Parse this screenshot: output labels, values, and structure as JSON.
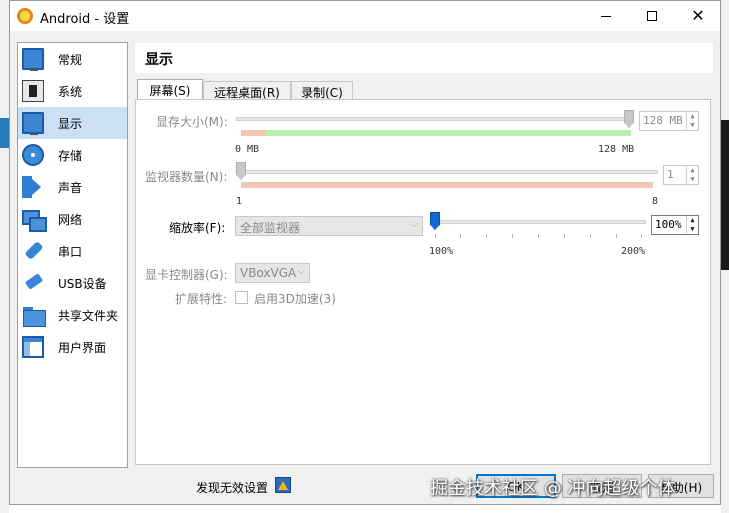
{
  "window": {
    "title": "Android - 设置"
  },
  "sidebar": {
    "items": [
      {
        "label": "常规",
        "icon": "general-monitor-icon"
      },
      {
        "label": "系统",
        "icon": "system-chip-icon"
      },
      {
        "label": "显示",
        "icon": "display-monitor-icon",
        "active": true
      },
      {
        "label": "存储",
        "icon": "storage-disk-icon"
      },
      {
        "label": "声音",
        "icon": "speaker-icon"
      },
      {
        "label": "网络",
        "icon": "network-icon"
      },
      {
        "label": "串口",
        "icon": "serial-port-icon"
      },
      {
        "label": "USB设备",
        "icon": "usb-icon"
      },
      {
        "label": "共享文件夹",
        "icon": "folder-icon"
      },
      {
        "label": "用户界面",
        "icon": "user-interface-icon"
      }
    ]
  },
  "main": {
    "title": "显示",
    "tabs": [
      {
        "label": "屏幕(S)",
        "active": true
      },
      {
        "label": "远程桌面(R)"
      },
      {
        "label": "录制(C)"
      }
    ],
    "video_memory": {
      "label": "显存大小(M):",
      "value": "128 MB",
      "slider_fraction": 1.0,
      "min_label": "0 MB",
      "max_label": "128 MB"
    },
    "monitor_count": {
      "label": "监视器数量(N):",
      "value": "1",
      "slider_fraction": 0.0,
      "min_label": "1",
      "max_label": "8"
    },
    "scale_factor": {
      "label": "缩放率(F):",
      "combo_value": "全部监视器",
      "value": "100%",
      "slider_fraction": 0.0,
      "min_label": "100%",
      "max_label": "200%"
    },
    "graphics_controller": {
      "label": "显卡控制器(G):",
      "value": "VBoxVGA"
    },
    "acceleration": {
      "label": "扩展特性:",
      "checkbox_label": "启用3D加速(3)",
      "checked": false
    }
  },
  "footer": {
    "warning_text": "发现无效设置",
    "ok_label": "OK",
    "cancel_label": "取消",
    "help_label": "帮助(H)"
  },
  "watermark": "掘金技术社区 @ 冲向超级个体",
  "colors": {
    "accent": "#0078d7",
    "selected_item": "#cce0f5",
    "memory_range_ok": "#b8f0b0",
    "memory_range_warn": "#f4c7b4",
    "monitor_range": "#f4c7b4"
  }
}
